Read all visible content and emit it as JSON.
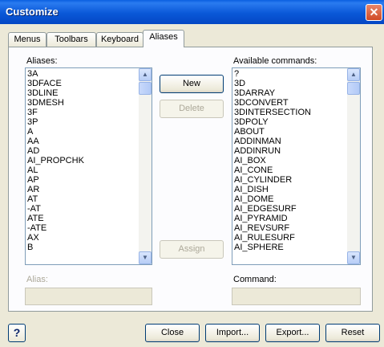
{
  "window": {
    "title": "Customize",
    "close_glyph": "✕"
  },
  "tabs": [
    {
      "label": "Menus"
    },
    {
      "label": "Toolbars"
    },
    {
      "label": "Keyboard"
    },
    {
      "label": "Aliases",
      "active": true
    }
  ],
  "aliases": {
    "label": "Aliases:",
    "items": [
      "3A",
      "3DFACE",
      "3DLINE",
      "3DMESH",
      "3F",
      "3P",
      "A",
      "AA",
      "AD",
      "AI_PROPCHK",
      "AL",
      "AP",
      "AR",
      "AT",
      "-AT",
      "ATE",
      "-ATE",
      "AX",
      "B"
    ]
  },
  "available_commands": {
    "label": "Available commands:",
    "items": [
      "?",
      "3D",
      "3DARRAY",
      "3DCONVERT",
      "3DINTERSECTION",
      "3DPOLY",
      "ABOUT",
      "ADDINMAN",
      "ADDINRUN",
      "AI_BOX",
      "AI_CONE",
      "AI_CYLINDER",
      "AI_DISH",
      "AI_DOME",
      "AI_EDGESURF",
      "AI_PYRAMID",
      "AI_REVSURF",
      "AI_RULESURF",
      "AI_SPHERE"
    ]
  },
  "buttons": {
    "new": "New",
    "delete": "Delete",
    "assign": "Assign",
    "close": "Close",
    "import": "Import...",
    "export": "Export...",
    "reset": "Reset",
    "help": "?"
  },
  "fields": {
    "alias_label": "Alias:",
    "alias_value": "",
    "command_label": "Command:",
    "command_value": ""
  },
  "scroll_glyphs": {
    "up": "▲",
    "down": "▼"
  }
}
